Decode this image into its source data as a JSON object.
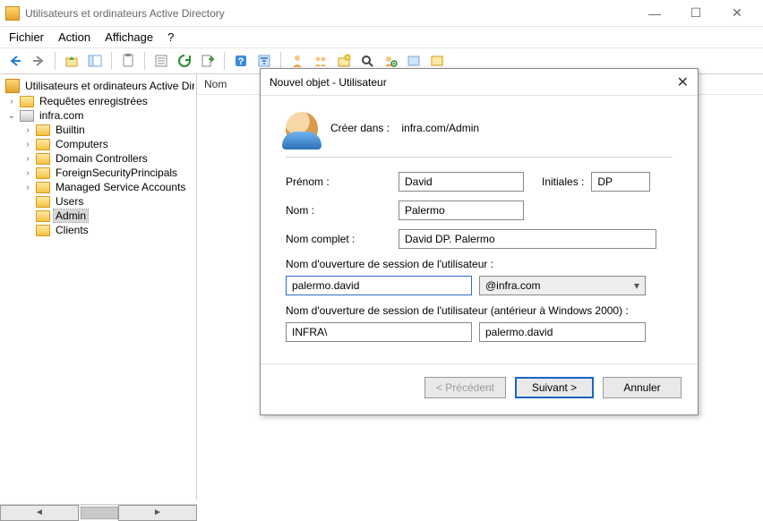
{
  "window": {
    "title": "Utilisateurs et ordinateurs Active Directory"
  },
  "menu": {
    "file": "Fichier",
    "action": "Action",
    "view": "Affichage",
    "help": "?"
  },
  "tree": {
    "root": "Utilisateurs et ordinateurs Active Directory",
    "savedQueries": "Requêtes enregistrées",
    "domain": "infra.com",
    "nodes": {
      "builtin": "Builtin",
      "computers": "Computers",
      "dc": "Domain Controllers",
      "fsp": "ForeignSecurityPrincipals",
      "msa": "Managed Service Accounts",
      "users": "Users",
      "admin": "Admin",
      "clients": "Clients"
    }
  },
  "list": {
    "header_name": "Nom"
  },
  "dialog": {
    "title": "Nouvel objet - Utilisateur",
    "create_in_label": "Créer dans :",
    "create_in_path": "infra.com/Admin",
    "labels": {
      "first": "Prénom :",
      "initials": "Initiales :",
      "last": "Nom :",
      "full": "Nom complet :",
      "logon": "Nom d'ouverture de session de l'utilisateur :",
      "prewin": "Nom d'ouverture de session de l'utilisateur (antérieur à Windows 2000) :"
    },
    "values": {
      "first": "David",
      "initials": "DP",
      "last": "Palermo",
      "full": "David DP. Palermo",
      "logon": "palermo.david",
      "domain": "@infra.com",
      "netbios": "INFRA\\",
      "sam": "palermo.david"
    },
    "buttons": {
      "back": "< Précédent",
      "next": "Suivant >",
      "cancel": "Annuler"
    }
  }
}
